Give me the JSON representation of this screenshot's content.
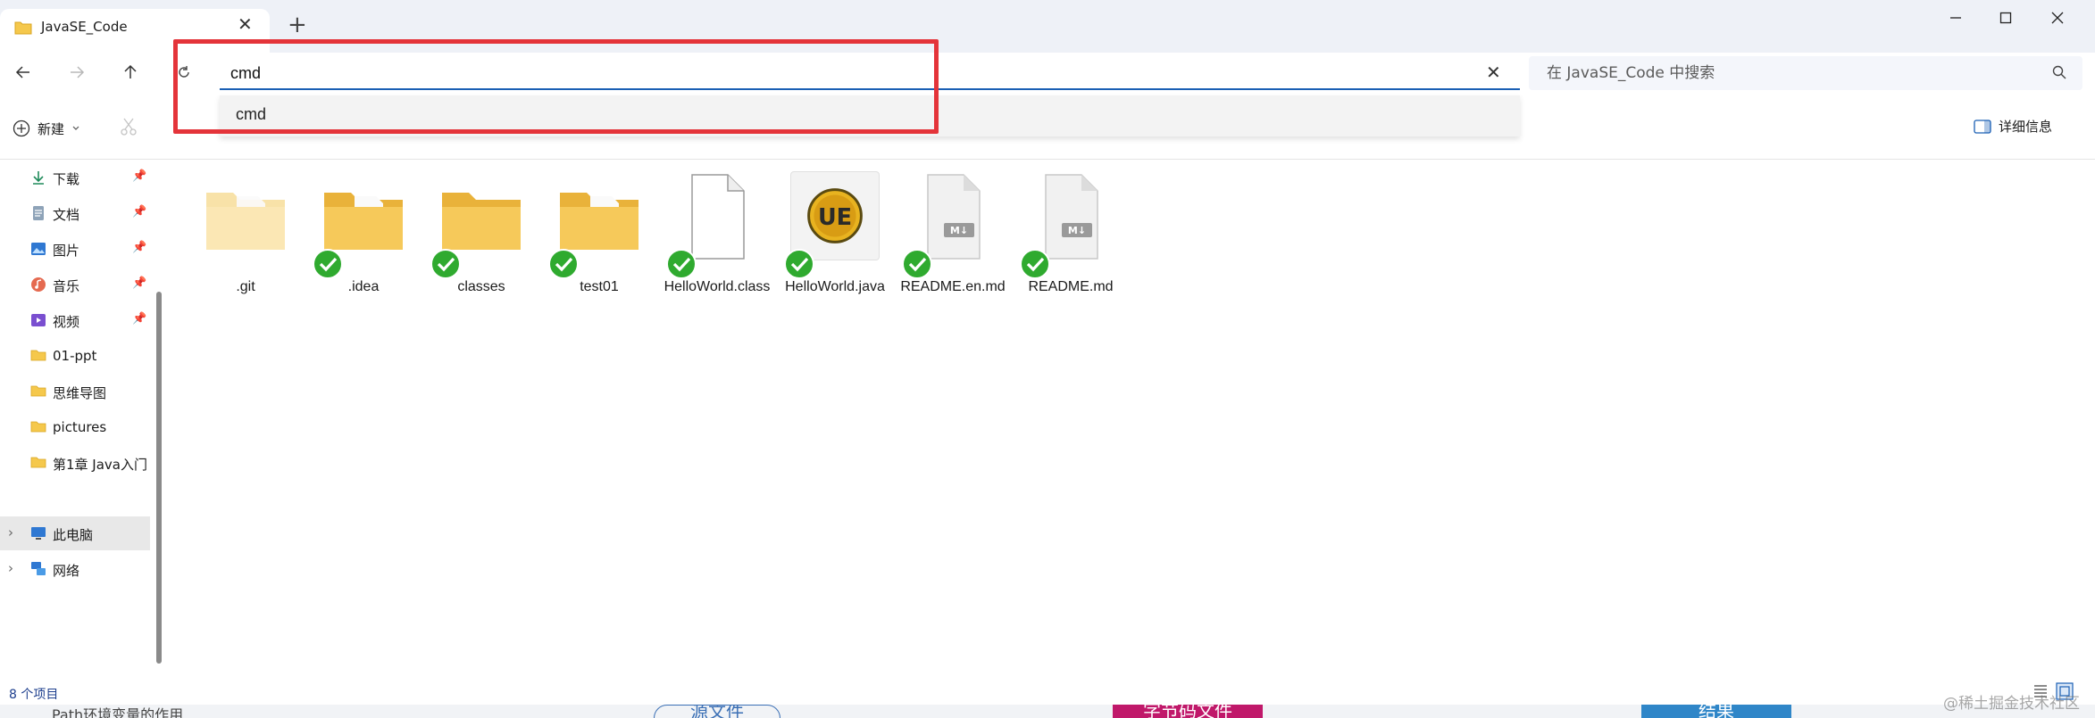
{
  "window": {
    "tab_title": "JavaSE_Code",
    "tab_close": "✕",
    "new_tab": "+"
  },
  "address_bar": {
    "value": "cmd",
    "clear": "✕"
  },
  "search": {
    "placeholder": "在 JavaSE_Code 中搜索"
  },
  "autocomplete": {
    "suggestions": [
      "cmd"
    ]
  },
  "toolbar": {
    "new_label": "新建",
    "details_label": "详细信息"
  },
  "sidebar": {
    "quick_access": [
      {
        "label": "下载",
        "icon": "download-icon",
        "pinned": true
      },
      {
        "label": "文档",
        "icon": "document-icon",
        "pinned": true
      },
      {
        "label": "图片",
        "icon": "picture-icon",
        "pinned": true
      },
      {
        "label": "音乐",
        "icon": "music-icon",
        "pinned": true
      },
      {
        "label": "视频",
        "icon": "video-icon",
        "pinned": true
      },
      {
        "label": "01-ppt",
        "icon": "folder-icon",
        "pinned": false
      },
      {
        "label": "思维导图",
        "icon": "folder-icon",
        "pinned": false
      },
      {
        "label": "pictures",
        "icon": "folder-icon",
        "pinned": false
      },
      {
        "label": "第1章 Java入门",
        "icon": "folder-icon",
        "pinned": false
      }
    ],
    "locations": [
      {
        "label": "此电脑",
        "icon": "computer-icon",
        "selected": true
      },
      {
        "label": "网络",
        "icon": "network-icon",
        "selected": false
      }
    ]
  },
  "files": [
    {
      "name": ".git",
      "type": "folder-hidden",
      "synced": false
    },
    {
      "name": ".idea",
      "type": "folder-doc",
      "synced": true
    },
    {
      "name": "classes",
      "type": "folder",
      "synced": true
    },
    {
      "name": "test01",
      "type": "folder-doc",
      "synced": true
    },
    {
      "name": "HelloWorld.class",
      "type": "blank-file",
      "synced": true
    },
    {
      "name": "HelloWorld.java",
      "type": "ultraedit-file",
      "synced": true
    },
    {
      "name": "README.en.md",
      "type": "markdown-file",
      "synced": true
    },
    {
      "name": "README.md",
      "type": "markdown-file",
      "synced": true
    }
  ],
  "status": {
    "item_count": "8 个项目"
  },
  "background": {
    "text1": "Path环境变量的作用",
    "pill1": "源文件",
    "pill2": "字节码文件",
    "pill3": "结果"
  },
  "watermark": "@稀土掘金技术社区",
  "colors": {
    "accent": "#1a5fb4",
    "highlight_box": "#e4343a",
    "sync_green": "#2faa2f",
    "folder": "#f5c84c"
  }
}
